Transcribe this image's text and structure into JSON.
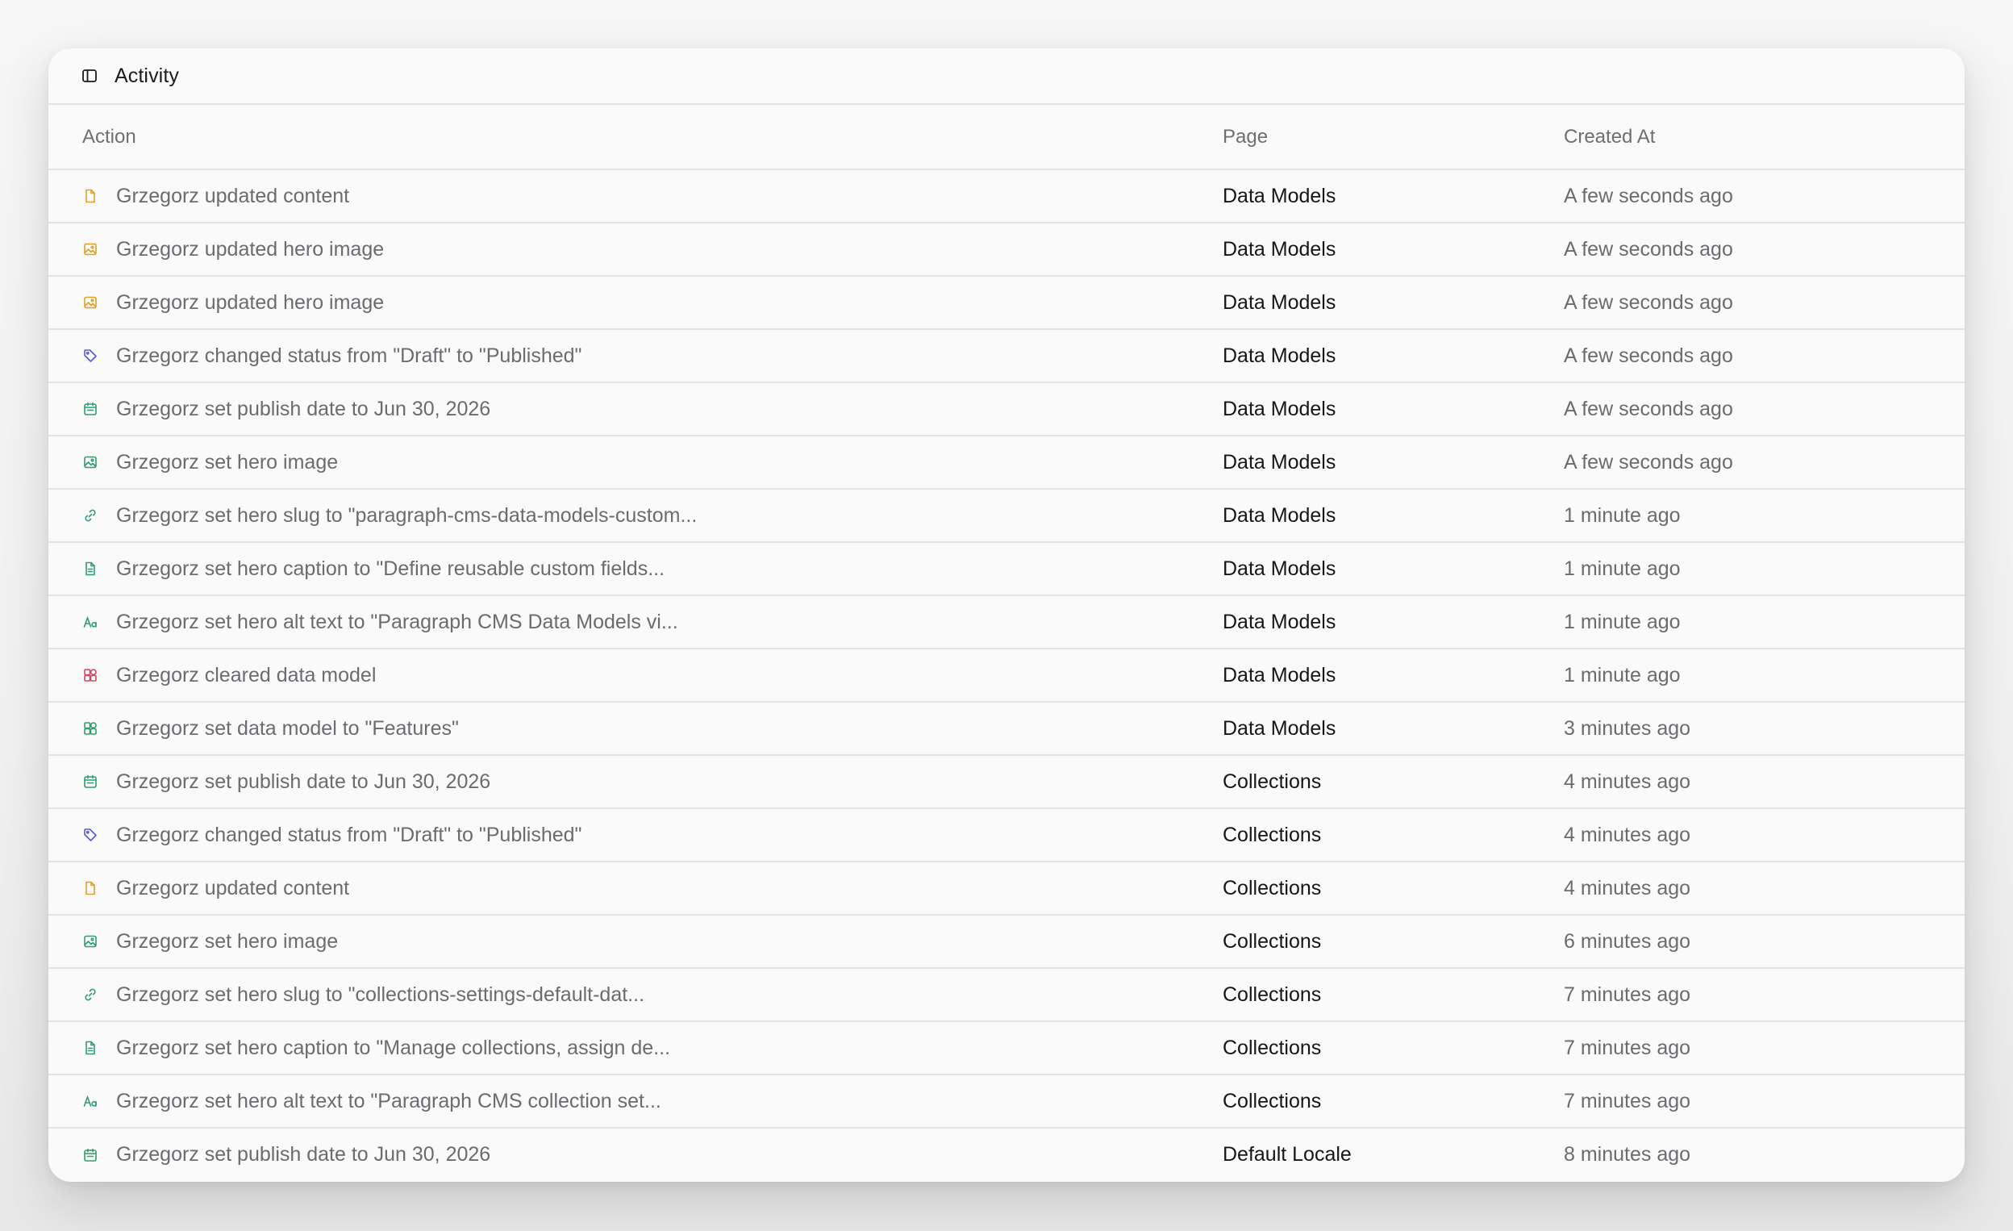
{
  "panel": {
    "title": "Activity",
    "icon": "sidebar-panel-icon"
  },
  "table": {
    "headers": {
      "action": "Action",
      "page": "Page",
      "created_at": "Created At"
    },
    "rows": [
      {
        "icon": "file-icon",
        "color": "#e0a020",
        "action": "Grzegorz updated content",
        "page": "Data Models",
        "created": "A few seconds ago"
      },
      {
        "icon": "image-icon",
        "color": "#e0a020",
        "action": "Grzegorz updated hero image",
        "page": "Data Models",
        "created": "A few seconds ago"
      },
      {
        "icon": "image-icon",
        "color": "#e0a020",
        "action": "Grzegorz updated hero image",
        "page": "Data Models",
        "created": "A few seconds ago"
      },
      {
        "icon": "tag-icon",
        "color": "#5b5bd6",
        "action": "Grzegorz changed status from \"Draft\" to \"Published\"",
        "page": "Data Models",
        "created": "A few seconds ago"
      },
      {
        "icon": "calendar-icon",
        "color": "#2f9e6e",
        "action": "Grzegorz set publish date to Jun 30, 2026",
        "page": "Data Models",
        "created": "A few seconds ago"
      },
      {
        "icon": "image-icon",
        "color": "#2f9e6e",
        "action": "Grzegorz set hero image",
        "page": "Data Models",
        "created": "A few seconds ago"
      },
      {
        "icon": "link-icon",
        "color": "#2f9e6e",
        "action": "Grzegorz set hero slug to \"paragraph-cms-data-models-custom...",
        "page": "Data Models",
        "created": "1 minute ago"
      },
      {
        "icon": "document-icon",
        "color": "#2f9e6e",
        "action": "Grzegorz set hero caption to \"Define reusable custom fields...",
        "page": "Data Models",
        "created": "1 minute ago"
      },
      {
        "icon": "text-icon",
        "color": "#2f9e6e",
        "action": "Grzegorz set hero alt text to \"Paragraph CMS Data Models vi...",
        "page": "Data Models",
        "created": "1 minute ago"
      },
      {
        "icon": "blocks-icon",
        "color": "#d6455d",
        "action": "Grzegorz cleared data model",
        "page": "Data Models",
        "created": "1 minute ago"
      },
      {
        "icon": "blocks-icon",
        "color": "#2f9e6e",
        "action": "Grzegorz set data model to \"Features\"",
        "page": "Data Models",
        "created": "3 minutes ago"
      },
      {
        "icon": "calendar-icon",
        "color": "#2f9e6e",
        "action": "Grzegorz set publish date to Jun 30, 2026",
        "page": "Collections",
        "created": "4 minutes ago"
      },
      {
        "icon": "tag-icon",
        "color": "#5b5bd6",
        "action": "Grzegorz changed status from \"Draft\" to \"Published\"",
        "page": "Collections",
        "created": "4 minutes ago"
      },
      {
        "icon": "file-icon",
        "color": "#e0a020",
        "action": "Grzegorz updated content",
        "page": "Collections",
        "created": "4 minutes ago"
      },
      {
        "icon": "image-icon",
        "color": "#2f9e6e",
        "action": "Grzegorz set hero image",
        "page": "Collections",
        "created": "6 minutes ago"
      },
      {
        "icon": "link-icon",
        "color": "#2f9e6e",
        "action": "Grzegorz set hero slug to \"collections-settings-default-dat...",
        "page": "Collections",
        "created": "7 minutes ago"
      },
      {
        "icon": "document-icon",
        "color": "#2f9e6e",
        "action": "Grzegorz set hero caption to \"Manage collections, assign de...",
        "page": "Collections",
        "created": "7 minutes ago"
      },
      {
        "icon": "text-icon",
        "color": "#2f9e6e",
        "action": "Grzegorz set hero alt text to \"Paragraph CMS collection set...",
        "page": "Collections",
        "created": "7 minutes ago"
      },
      {
        "icon": "calendar-icon",
        "color": "#2f9e6e",
        "action": "Grzegorz set publish date to Jun 30, 2026",
        "page": "Default Locale",
        "created": "8 minutes ago"
      }
    ]
  }
}
